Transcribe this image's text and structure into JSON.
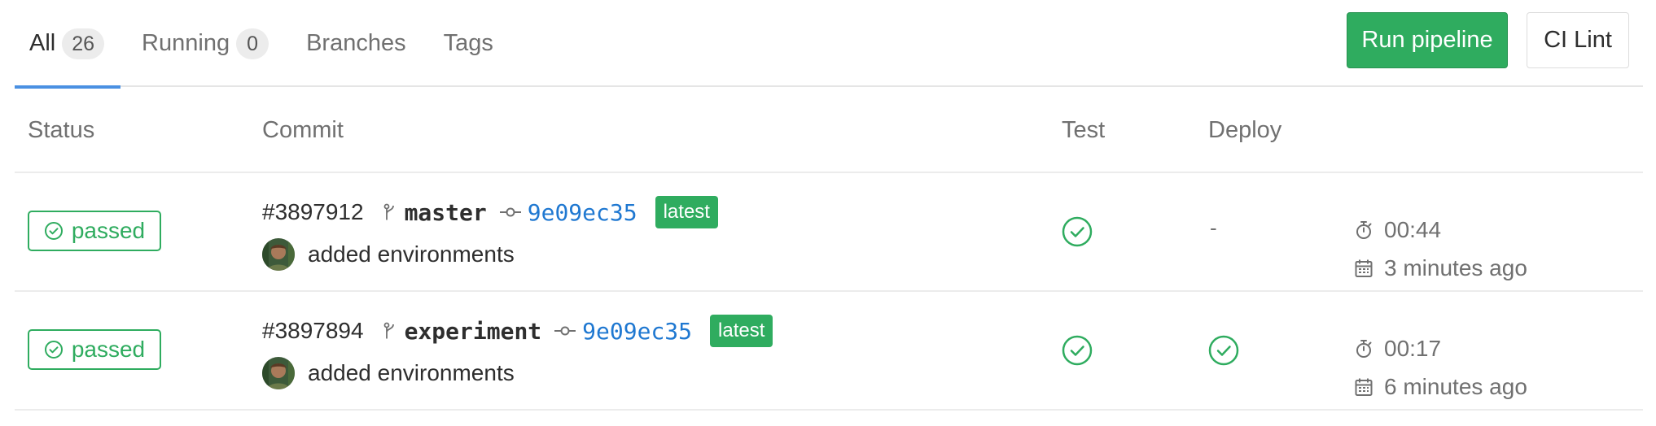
{
  "tabs": [
    {
      "label": "All",
      "count": "26"
    },
    {
      "label": "Running",
      "count": "0"
    },
    {
      "label": "Branches"
    },
    {
      "label": "Tags"
    }
  ],
  "actions": {
    "run_pipeline": "Run pipeline",
    "ci_lint": "CI Lint"
  },
  "table": {
    "headers": {
      "status": "Status",
      "commit": "Commit",
      "test": "Test",
      "deploy": "Deploy"
    },
    "rows": [
      {
        "status": "passed",
        "pipeline_id": "#3897912",
        "branch": "master",
        "sha": "9e09ec35",
        "badge": "latest",
        "message": "added environments",
        "test_stage": "success",
        "deploy_stage": "-",
        "duration": "00:44",
        "finished": "3 minutes ago"
      },
      {
        "status": "passed",
        "pipeline_id": "#3897894",
        "branch": "experiment",
        "sha": "9e09ec35",
        "badge": "latest",
        "message": "added environments",
        "test_stage": "success",
        "deploy_stage": "success",
        "duration": "00:17",
        "finished": "6 minutes ago"
      }
    ]
  },
  "colors": {
    "success": "#2fac5f",
    "link": "#1f78d1",
    "active_tab": "#4a90e2"
  },
  "icons": [
    "check-circle-icon",
    "branch-icon",
    "commit-icon",
    "stopwatch-icon",
    "calendar-icon",
    "avatar"
  ]
}
